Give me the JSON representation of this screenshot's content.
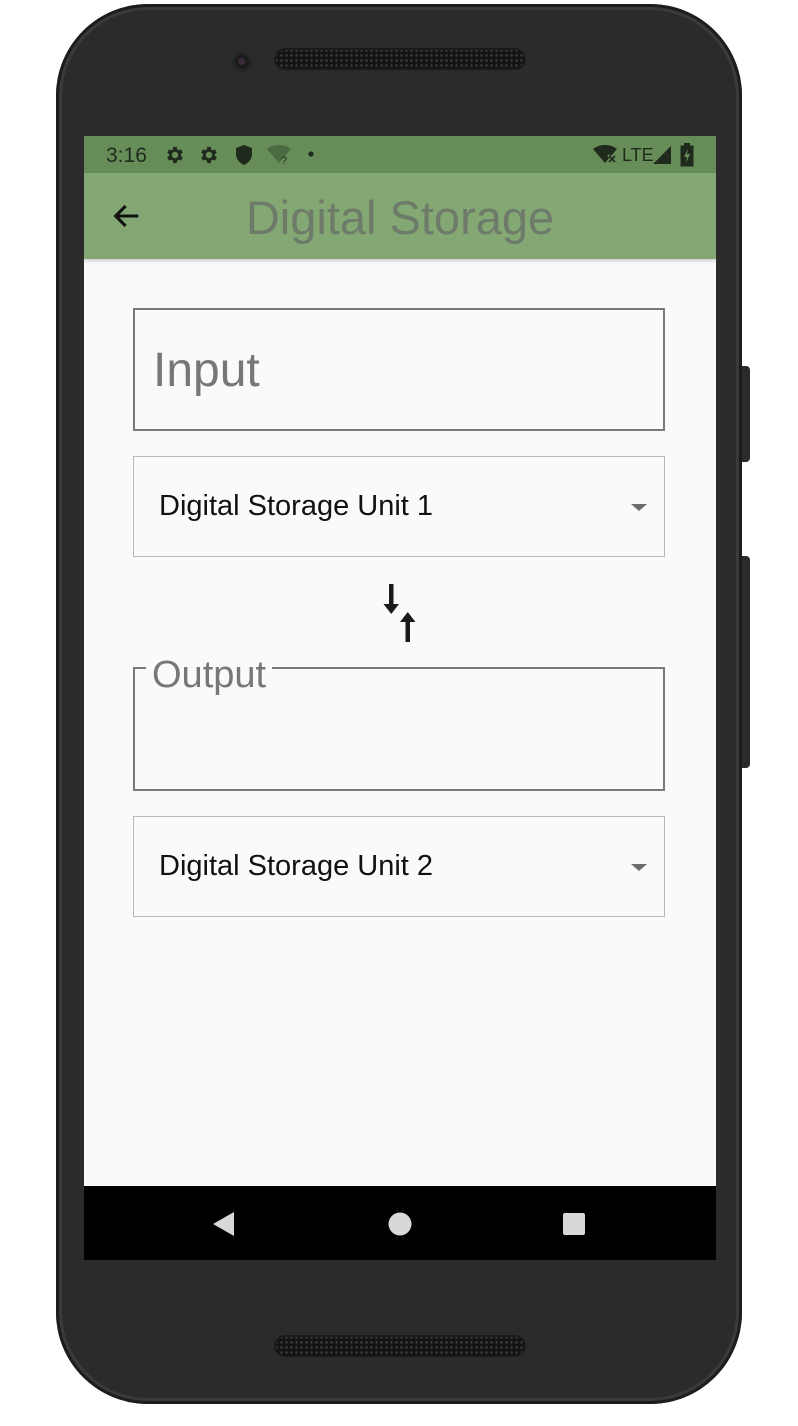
{
  "status_bar": {
    "time": "3:16",
    "network_label": "LTE",
    "icons": [
      "gear-icon",
      "gear-icon",
      "shield-icon",
      "wifi-question-icon",
      "dot-icon",
      "wifi-off-icon",
      "signal-icon",
      "battery-icon"
    ]
  },
  "app_bar": {
    "title": "Digital Storage",
    "back_icon": "arrow-left-icon",
    "background_color": "#83a873",
    "status_color": "#668d58"
  },
  "form": {
    "input_placeholder": "Input",
    "unit_from": "Digital Storage Unit 1",
    "swap_icon": "swap-vertical-icon",
    "output_label": "Output",
    "output_value": "",
    "unit_to": "Digital Storage Unit 2"
  },
  "nav_bar": {
    "icons": [
      "back-triangle-icon",
      "home-circle-icon",
      "recents-square-icon"
    ]
  }
}
